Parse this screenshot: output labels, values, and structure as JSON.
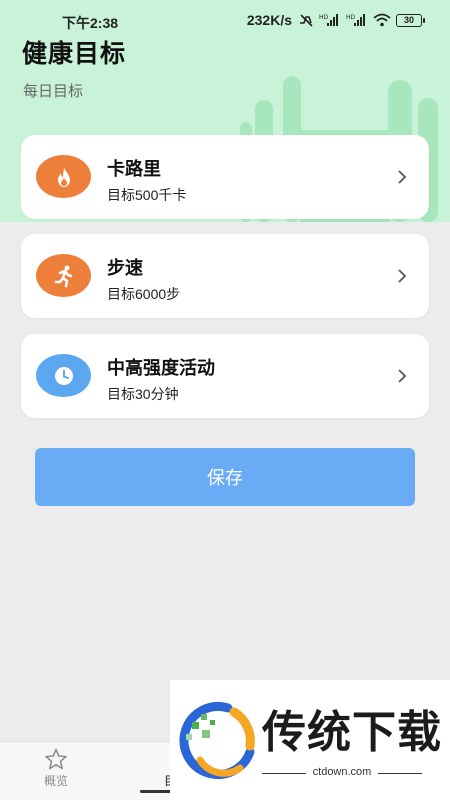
{
  "status_bar": {
    "time": "下午2:38",
    "speed": "232K/s",
    "battery": "30"
  },
  "header": {
    "title": "健康目标",
    "subtitle": "每日目标"
  },
  "goals": [
    {
      "title": "卡路里",
      "target": "目标500千卡",
      "icon": "fire-icon",
      "color": "#ee7f3a"
    },
    {
      "title": "步速",
      "target": "目标6000步",
      "icon": "running-icon",
      "color": "#ee7f3a"
    },
    {
      "title": "中高强度活动",
      "target": "目标30分钟",
      "icon": "clock-icon",
      "color": "#5ba8f0"
    }
  ],
  "save_button": {
    "label": "保存"
  },
  "tabbar": {
    "tabs": [
      {
        "label": "概览",
        "icon": "star-icon"
      },
      {
        "label": "目",
        "icon": "target-icon",
        "active": true
      }
    ]
  },
  "watermark": {
    "brand": "传统下载",
    "url": "ctdown.com"
  },
  "colors": {
    "header_bg": "#c9f3d9",
    "accent_orange": "#ee7f3a",
    "accent_blue": "#5ba8f0",
    "save_button": "#6aabf5",
    "page_bg": "#ececec"
  }
}
